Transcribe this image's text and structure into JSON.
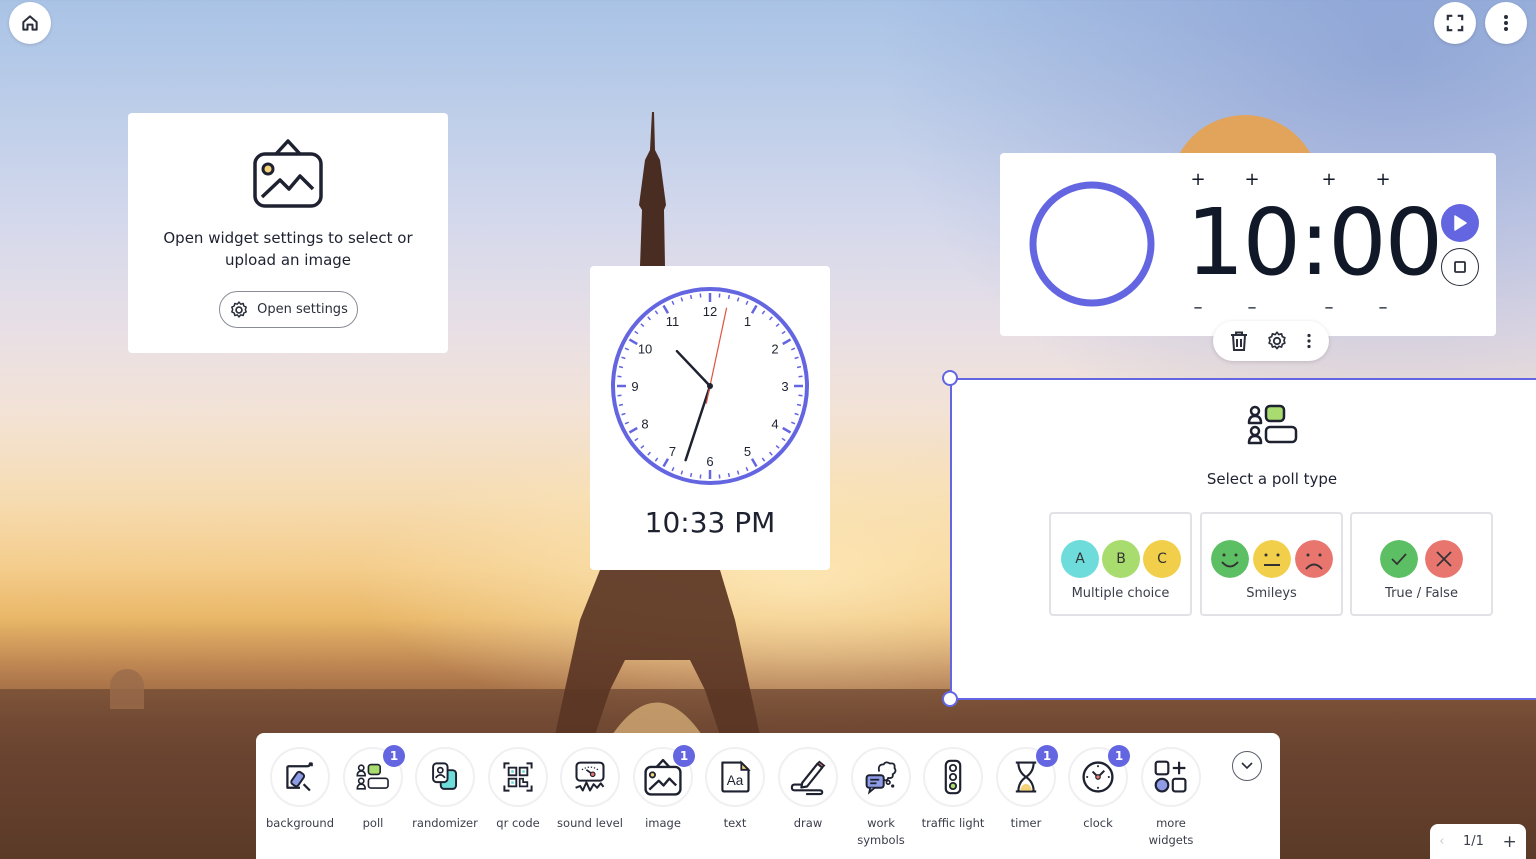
{
  "top_bar": {
    "home_icon": "home-icon",
    "fullscreen_icon": "fullscreen-icon",
    "more_icon": "more-vertical-icon"
  },
  "image_widget": {
    "icon": "image-icon",
    "message": "Open widget settings to select or upload an image",
    "button_label": "Open settings",
    "button_icon": "gear-icon"
  },
  "clock_widget": {
    "numbers": [
      "12",
      "1",
      "2",
      "3",
      "4",
      "5",
      "6",
      "7",
      "8",
      "9",
      "10",
      "11"
    ],
    "hour": 10,
    "minute": 33,
    "second": 2,
    "digital_time": "10:33 PM",
    "accent_color": "#6366e0"
  },
  "timer_widget": {
    "display": "10:00",
    "plus_label": "+",
    "minus_label": "–",
    "play_icon": "play-icon",
    "stop_icon": "stop-icon",
    "progress": 1.0,
    "accent_color": "#6366e0"
  },
  "widget_toolbar": {
    "delete_icon": "trash-icon",
    "settings_icon": "gear-icon",
    "more_icon": "more-vertical-icon"
  },
  "poll_widget": {
    "icon": "poll-icon",
    "title": "Select a poll type",
    "options": [
      {
        "label": "Multiple choice",
        "bubbles": [
          "A",
          "B",
          "C"
        ],
        "colors": [
          "#6fdcdc",
          "#a9dc6e",
          "#f2cf4a"
        ]
      },
      {
        "label": "Smileys",
        "bubbles": [
          "happy",
          "neutral",
          "sad"
        ],
        "colors": [
          "#5cbf63",
          "#f2cf4a",
          "#e9756f"
        ]
      },
      {
        "label": "True / False",
        "bubbles": [
          "check",
          "cross"
        ],
        "colors": [
          "#5cbf63",
          "#e9756f"
        ]
      }
    ]
  },
  "dock": {
    "items": [
      {
        "label": "background",
        "icon": "paint-roller-icon",
        "badge": null
      },
      {
        "label": "poll",
        "icon": "poll-icon",
        "badge": "1"
      },
      {
        "label": "randomizer",
        "icon": "randomizer-icon",
        "badge": null
      },
      {
        "label": "qr code",
        "icon": "qr-code-icon",
        "badge": null
      },
      {
        "label": "sound level",
        "icon": "sound-level-icon",
        "badge": null
      },
      {
        "label": "image",
        "icon": "image-icon",
        "badge": "1"
      },
      {
        "label": "text",
        "icon": "text-icon",
        "badge": null
      },
      {
        "label": "draw",
        "icon": "pencil-icon",
        "badge": null
      },
      {
        "label": "work symbols",
        "icon": "work-symbols-icon",
        "badge": null
      },
      {
        "label": "traffic light",
        "icon": "traffic-light-icon",
        "badge": null
      },
      {
        "label": "timer",
        "icon": "hourglass-icon",
        "badge": "1"
      },
      {
        "label": "clock",
        "icon": "clock-icon",
        "badge": "1"
      },
      {
        "label": "more widgets",
        "icon": "more-widgets-icon",
        "badge": null
      }
    ],
    "collapse_icon": "chevron-down-icon"
  },
  "pager": {
    "prev_label": "‹",
    "page": "1/1",
    "add_label": "+"
  }
}
